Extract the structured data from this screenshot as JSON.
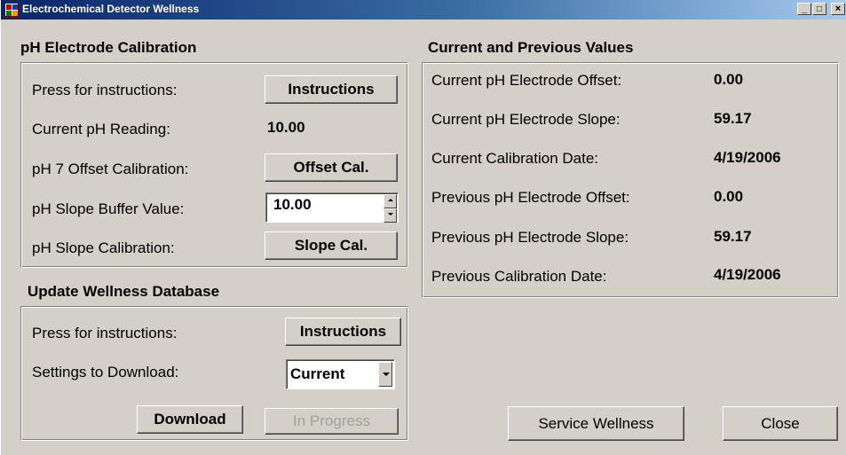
{
  "window": {
    "title": "Electrochemical Detector Wellness",
    "controls": {
      "minimize": "_",
      "maximize": "□",
      "close": "×"
    }
  },
  "ph_calibration": {
    "title": "pH Electrode Calibration",
    "instructions_label": "Press for instructions:",
    "instructions_button": "Instructions",
    "current_reading_label": "Current pH Reading:",
    "current_reading_value": "10.00",
    "offset_label": "pH 7 Offset Calibration:",
    "offset_button": "Offset Cal.",
    "buffer_label": "pH Slope Buffer Value:",
    "buffer_value": "10.00",
    "slope_label": "pH Slope Calibration:",
    "slope_button": "Slope Cal."
  },
  "current_previous": {
    "title": "Current and Previous Values",
    "rows": [
      {
        "label": "Current pH Electrode Offset:",
        "value": "0.00"
      },
      {
        "label": "Current pH Electrode Slope:",
        "value": "59.17"
      },
      {
        "label": "Current Calibration Date:",
        "value": "4/19/2006"
      },
      {
        "label": "Previous pH Electrode Offset:",
        "value": "0.00"
      },
      {
        "label": "Previous pH Electrode Slope:",
        "value": "59.17"
      },
      {
        "label": "Previous Calibration Date:",
        "value": "4/19/2006"
      }
    ]
  },
  "update_db": {
    "title": "Update Wellness Database",
    "instructions_label": "Press for instructions:",
    "instructions_button": "Instructions",
    "settings_label": "Settings to Download:",
    "settings_selected": "Current",
    "download_button": "Download",
    "progress_button": "In Progress"
  },
  "footer": {
    "service_button": "Service Wellness",
    "close_button": "Close"
  },
  "colors": {
    "face": "#d4d0c8",
    "title_gradient_start": "#0a246a",
    "disabled_text": "#a0a0a0"
  }
}
